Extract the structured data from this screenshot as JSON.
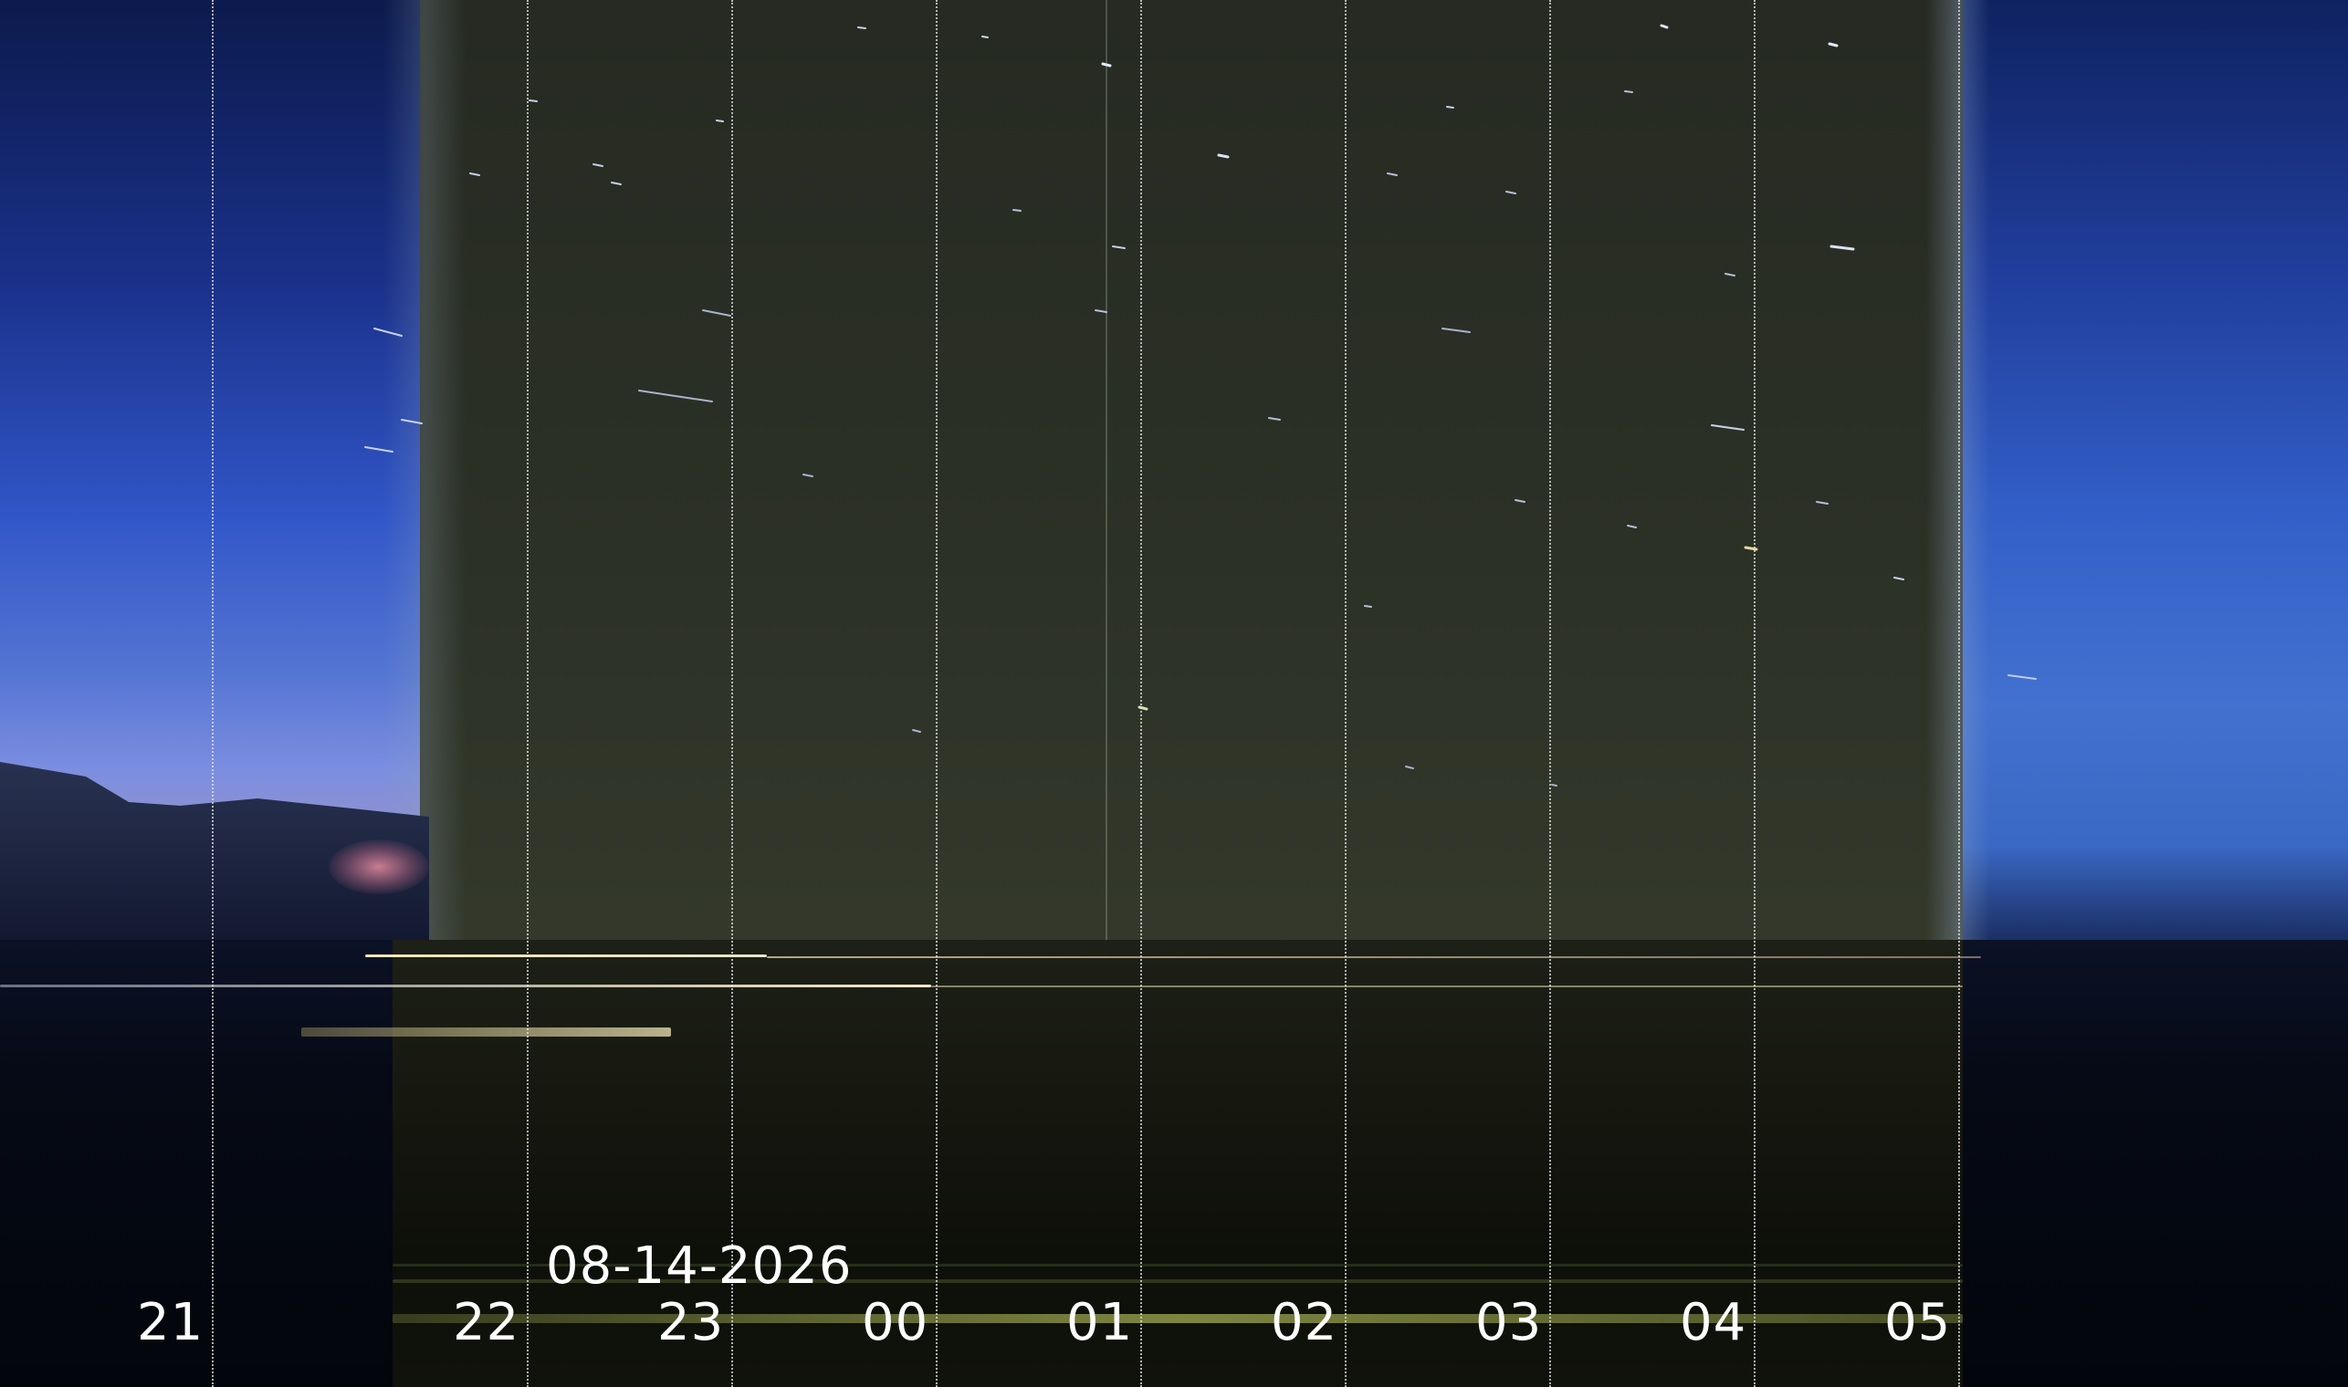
{
  "date_label": "08-14-2026",
  "time_ticks": [
    "21",
    "22",
    "23",
    "00",
    "01",
    "02",
    "03",
    "04",
    "05"
  ]
}
